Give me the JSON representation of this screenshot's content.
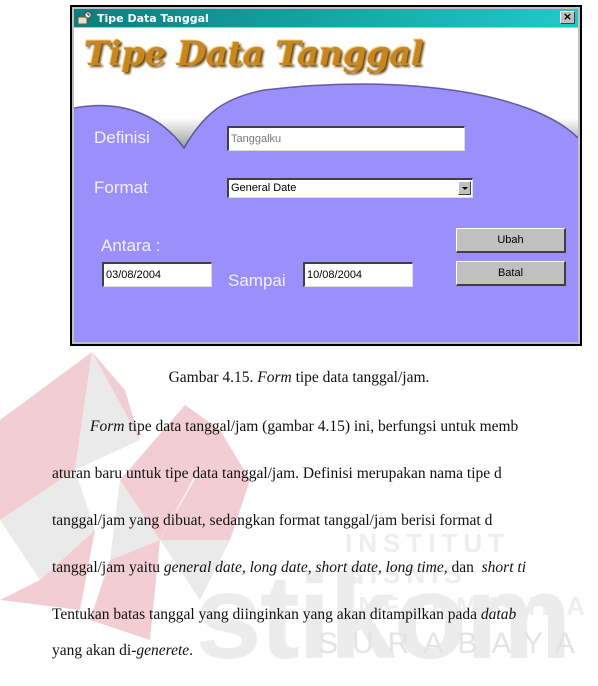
{
  "window": {
    "title": "Tipe Data Tanggal",
    "title_icon": "app-form-icon",
    "close_label": "×",
    "close_icon": "close-icon",
    "header_title": "Tipe Data Tanggal",
    "accent_color": "#9b8ffc",
    "titlebar_color": "#0a7f7f"
  },
  "form": {
    "definisi_label": "Definisi",
    "definisi_value": "Tanggalku",
    "format_label": "Format",
    "format_value": "General Date",
    "antara_label": "Antara :",
    "antara_value": "03/08/2004",
    "sampai_label": "Sampai",
    "sampai_value": "10/08/2004",
    "ubah_label": "Ubah",
    "batal_label": "Batal"
  },
  "document": {
    "caption_prefix": "Gambar 4.15. ",
    "caption_italic": "Form",
    "caption_suffix": " tipe data tanggal/jam.",
    "lines": [
      {
        "parts": [
          {
            "t": "Form",
            "i": true
          },
          {
            "t": " tipe data tanggal/jam (gambar 4.15) ini, berfungsi untuk memb",
            "i": false
          }
        ]
      },
      {
        "parts": [
          {
            "t": "aturan baru untuk tipe data tanggal/jam. Definisi merupakan nama tipe d",
            "i": false
          }
        ]
      },
      {
        "parts": [
          {
            "t": "tanggal/jam yang dibuat, sedangkan format tanggal/jam berisi format d",
            "i": false
          }
        ]
      },
      {
        "parts": [
          {
            "t": "tanggal/jam yaitu ",
            "i": false
          },
          {
            "t": "general date, long date, short date, long time,",
            "i": true
          },
          {
            "t": " dan ",
            "i": false
          },
          {
            "t": " short ti",
            "i": true
          }
        ]
      },
      {
        "parts": [
          {
            "t": "Tentukan batas tanggal yang diinginkan yang akan ditampilkan pada ",
            "i": false
          },
          {
            "t": "datab",
            "i": true
          }
        ]
      },
      {
        "parts": [
          {
            "t": "yang akan di-",
            "i": false
          },
          {
            "t": "generete",
            "i": true
          },
          {
            "t": ".",
            "i": false
          }
        ]
      }
    ]
  },
  "watermark": {
    "line1": "INSTITUT BISNIS",
    "line2": "& INFORMATIKA",
    "brand": "stikom",
    "city": "SURABAYA"
  }
}
